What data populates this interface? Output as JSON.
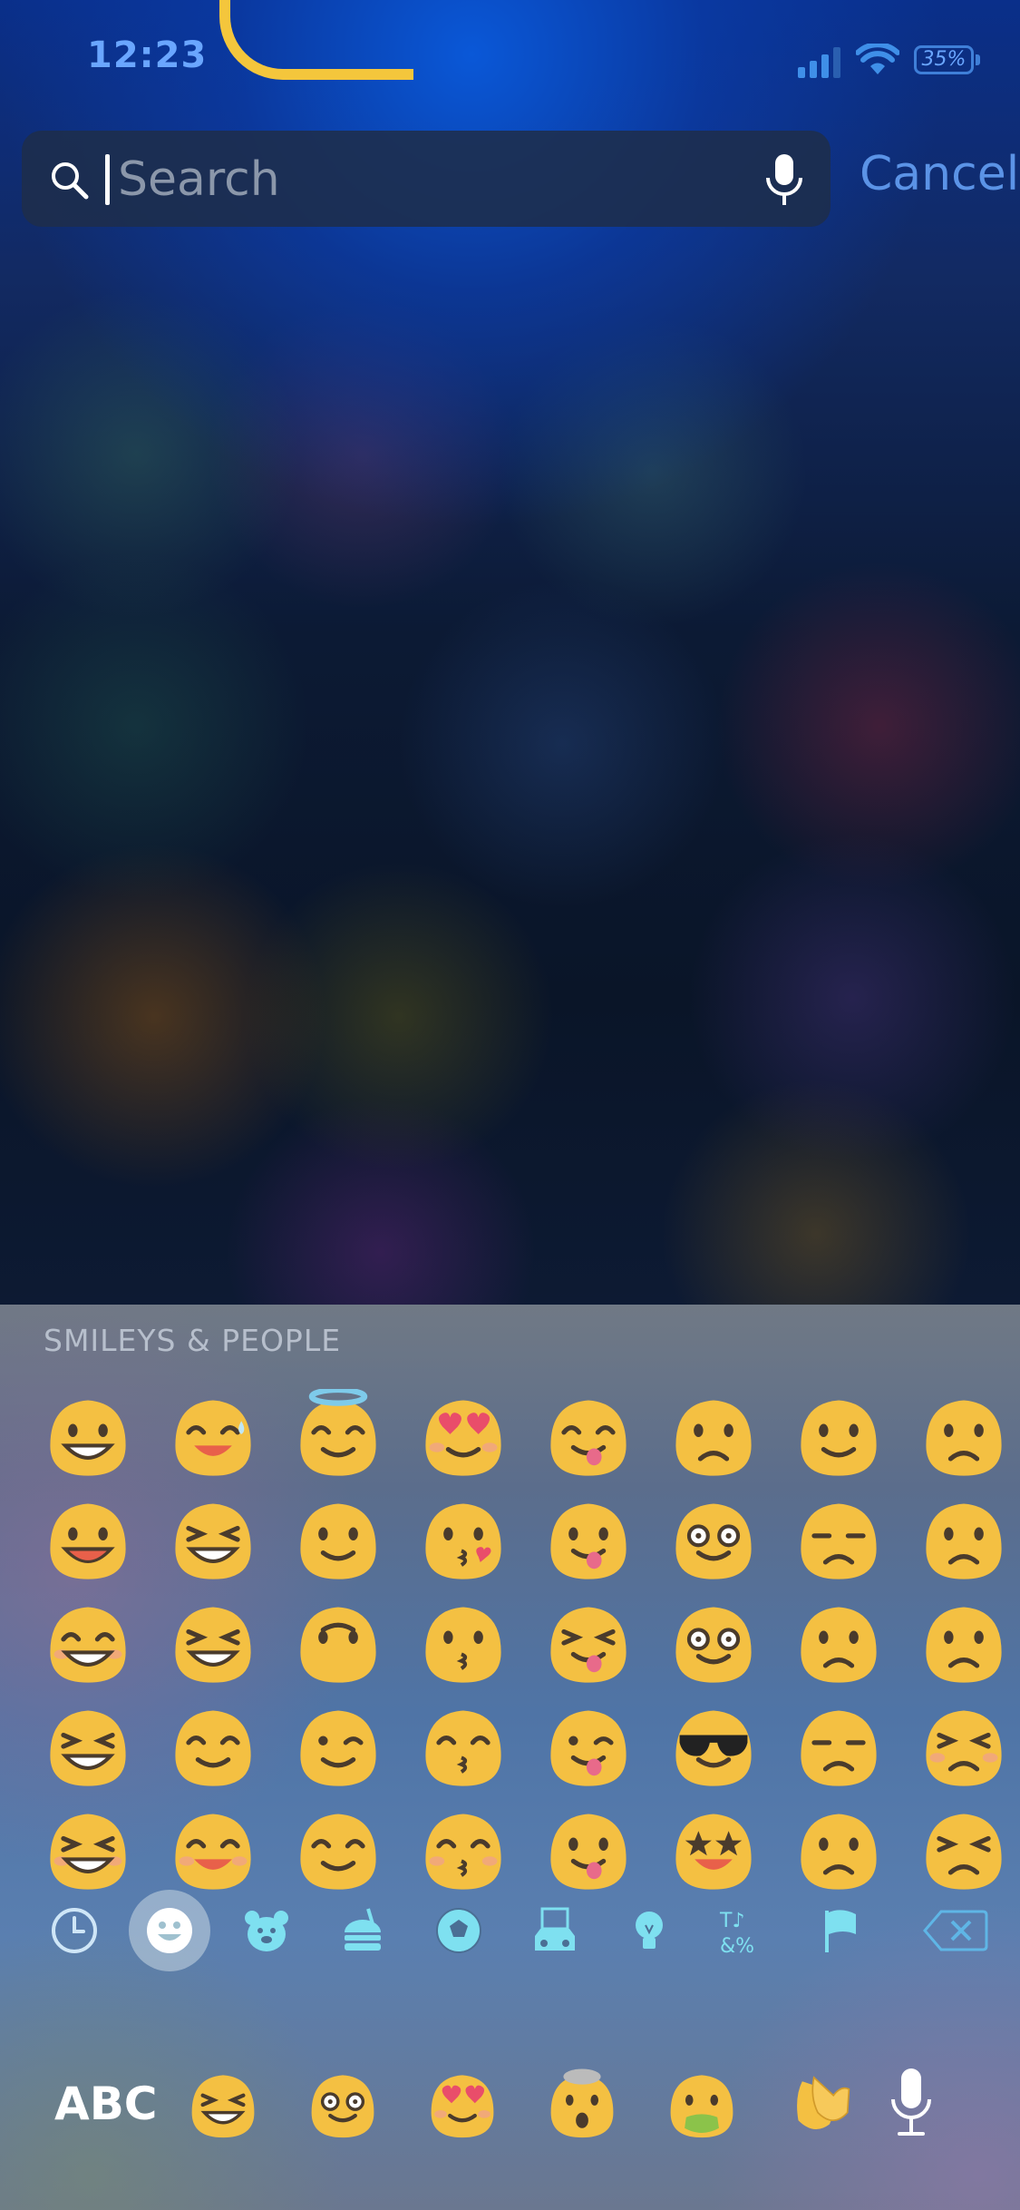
{
  "status_bar": {
    "time": "12:23",
    "battery": "35%",
    "accent_color": "#6aa6ff"
  },
  "search": {
    "placeholder": "Search",
    "value": "",
    "cancel_label": "Cancel"
  },
  "keyboard": {
    "section_title": "SMILEYS & PEOPLE",
    "emoji_grid": [
      "grinning-face",
      "smiling-face-with-sweat",
      "smiling-face-with-halo",
      "smiling-face-with-heart-eyes",
      "face-savoring-food",
      "face-with-raised-eyebrow",
      "smirking-face",
      "confused-face",
      "grinning-face-big-eyes",
      "face-with-tears-of-joy",
      "slightly-smiling-face",
      "face-blowing-a-kiss",
      "face-with-tongue",
      "face-with-monocle",
      "unamused-face",
      "slightly-frowning-face",
      "grinning-face-smiling-eyes",
      "rolling-on-floor-laughing",
      "upside-down-face",
      "kissing-face",
      "squinting-face-with-tongue",
      "nerd-face",
      "disappointed-face",
      "frowning-face",
      "beaming-face",
      "smiling-face",
      "winking-face",
      "kissing-face-smiling-eyes",
      "winking-face-with-tongue",
      "smiling-face-with-sunglasses",
      "pensive-face",
      "persevering-face",
      "grinning-squinting-face",
      "smiling-face-smiling-eyes",
      "relieved-face",
      "kissing-face-closed-eyes",
      "zany-face",
      "star-struck",
      "worried-face",
      "confounded-face"
    ],
    "categories": [
      "recent-clock-icon",
      "smileys-icon",
      "animals-icon",
      "food-icon",
      "activity-icon",
      "travel-icon",
      "objects-icon",
      "symbols-icon",
      "flags-icon",
      "delete-icon"
    ],
    "abc_label": "ABC",
    "recents": [
      "beaming-face",
      "face-with-monocle",
      "smiling-face-with-heart-eyes",
      "exploding-head",
      "face-vomiting",
      "clapping-hands"
    ]
  }
}
